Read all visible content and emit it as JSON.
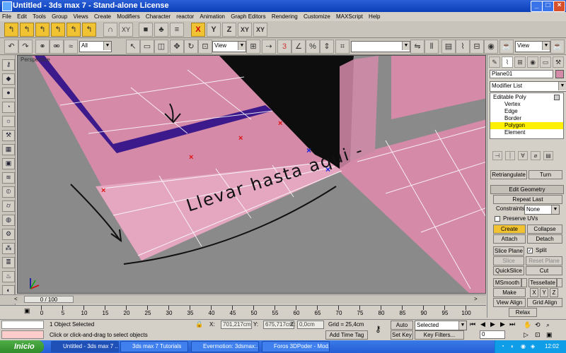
{
  "window": {
    "title": "Untitled - 3ds max 7 - Stand-alone License",
    "minimize_label": "_",
    "maximize_label": "□",
    "close_label": "×"
  },
  "menu": [
    "File",
    "Edit",
    "Tools",
    "Group",
    "Views",
    "Create",
    "Modifiers",
    "Character",
    "reactor",
    "Animation",
    "Graph Editors",
    "Rendering",
    "Customize",
    "MAXScript",
    "Help"
  ],
  "toolbar1": {
    "axis_labels": [
      "X",
      "Y",
      "Z",
      "XY",
      "XY"
    ],
    "xy_label": "XY"
  },
  "toolbar2": {
    "selection_filter": "All",
    "reference_coord": "View",
    "named_selection": "",
    "render_view": "View"
  },
  "viewport": {
    "label": "Perspective",
    "annotation": "Llevar hasta aqui -"
  },
  "command_panel": {
    "object_name": "Plane01",
    "modifier_list_label": "Modifier List",
    "stack": {
      "root": "Editable Poly",
      "items": [
        "Vertex",
        "Edge",
        "Border",
        "Polygon",
        "Element"
      ],
      "selected": "Polygon"
    },
    "buttons": {
      "retriangulate": "Retriangulate",
      "turn": "Turn",
      "edit_geometry": "Edit Geometry",
      "repeat_last": "Repeat Last",
      "constraints_label": "Constraints:",
      "constraints_value": "None",
      "preserve_uvs": "Preserve UVs",
      "create": "Create",
      "collapse": "Collapse",
      "attach": "Attach",
      "detach": "Detach",
      "slice_plane": "Slice Plane",
      "split": "Split",
      "slice": "Slice",
      "reset_plane": "Reset Plane",
      "quickslice": "QuickSlice",
      "cut": "Cut",
      "msmooth": "MSmooth",
      "tessellate": "Tessellate",
      "make_planar": "Make Planar",
      "x": "X",
      "y": "Y",
      "z": "Z",
      "view_align": "View Align",
      "grid_align": "Grid Align",
      "relax": "Relax"
    }
  },
  "timeline": {
    "frame_display": "0 / 100",
    "ticks": [
      "0",
      "5",
      "10",
      "15",
      "20",
      "25",
      "30",
      "35",
      "40",
      "45",
      "50",
      "55",
      "60",
      "65",
      "70",
      "75",
      "80",
      "85",
      "90",
      "95",
      "100"
    ]
  },
  "status": {
    "selected_count": "1 Object Selected",
    "prompt": "Click or click-and-drag to select objects",
    "x_label": "X:",
    "x_value": "701,217cm",
    "y_label": "Y:",
    "y_value": "675,717cm",
    "z_label": "Z:",
    "z_value": "0,0cm",
    "grid": "Grid = 25,4cm",
    "add_time_tag": "Add Time Tag",
    "auto_key": "Auto Key",
    "set_key": "Set Key",
    "key_mode": "Selected",
    "key_filters": "Key Filters...",
    "current_frame": "0"
  },
  "taskbar": {
    "start": "Inicio",
    "tasks": [
      {
        "label": "Untitled - 3ds max 7 ...",
        "active": true
      },
      {
        "label": "3ds max 7 Tutorials",
        "active": false
      },
      {
        "label": "Evermotion: 3dsmax:...",
        "active": false
      },
      {
        "label": "Foros 3DPoder - Mod...",
        "active": false
      }
    ],
    "language": "ES",
    "clock": "12:02"
  },
  "colors": {
    "plane_pink": "#d58aa8",
    "floor_gray": "#888888",
    "border_purple": "#3c1a8c",
    "selected_yellow": "#f1c232",
    "title_blue": "#0a3fb8"
  }
}
